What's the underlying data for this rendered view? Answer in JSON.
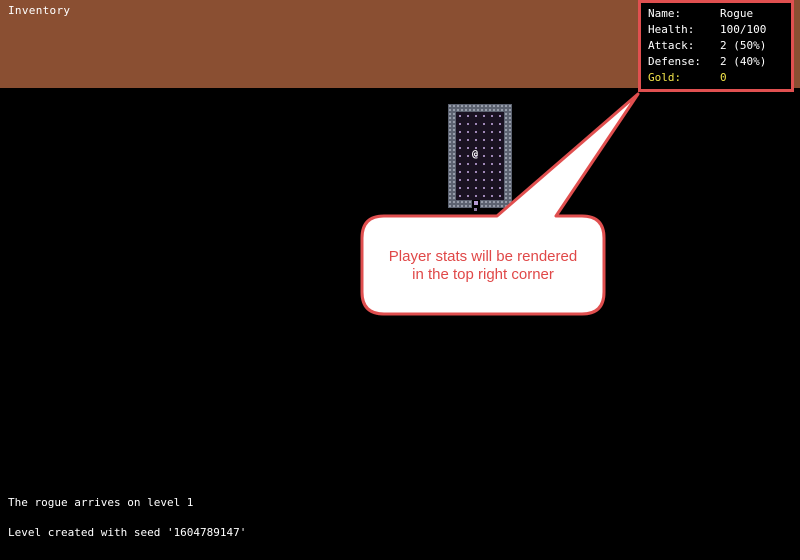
{
  "inventory": {
    "title": "Inventory"
  },
  "stats": {
    "name_label": "Name:",
    "name_value": "Rogue",
    "health_label": "Health:",
    "health_value": "100/100",
    "attack_label": "Attack:",
    "attack_value": "2 (50%)",
    "defense_label": "Defense:",
    "defense_value": "2 (40%)",
    "gold_label": "Gold:",
    "gold_value": "0"
  },
  "map": {
    "player_glyph": "@"
  },
  "callout": {
    "line1": "Player stats will be rendered",
    "line2": "in the top right corner"
  },
  "log": {
    "lines": [
      "The rogue arrives on level 1",
      "Level created with seed '1604789147'"
    ]
  },
  "colors": {
    "inventory_bg": "#8a4f32",
    "callout_red": "#e04848",
    "gold_text": "#f2e44a",
    "wall": "#5c6270"
  }
}
